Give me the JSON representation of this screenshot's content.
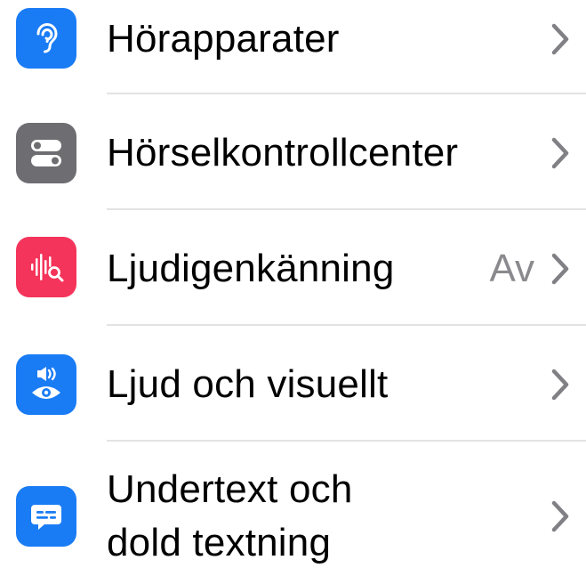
{
  "settings": {
    "items": [
      {
        "label": "Hörapparater",
        "value": "",
        "icon": "ear-icon",
        "color": "#1a7cf5"
      },
      {
        "label": "Hörselkontrollcenter",
        "value": "",
        "icon": "toggles-icon",
        "color": "#6d6d72"
      },
      {
        "label": "Ljudigenkänning",
        "value": "Av",
        "icon": "waveform-search-icon",
        "color": "#f4345a"
      },
      {
        "label": "Ljud och visuellt",
        "value": "",
        "icon": "speaker-eye-icon",
        "color": "#1a7cf5"
      },
      {
        "label_line1": "Undertext och",
        "label_line2": "dold textning",
        "value": "",
        "icon": "caption-bubble-icon",
        "color": "#1a7cf5"
      }
    ]
  }
}
